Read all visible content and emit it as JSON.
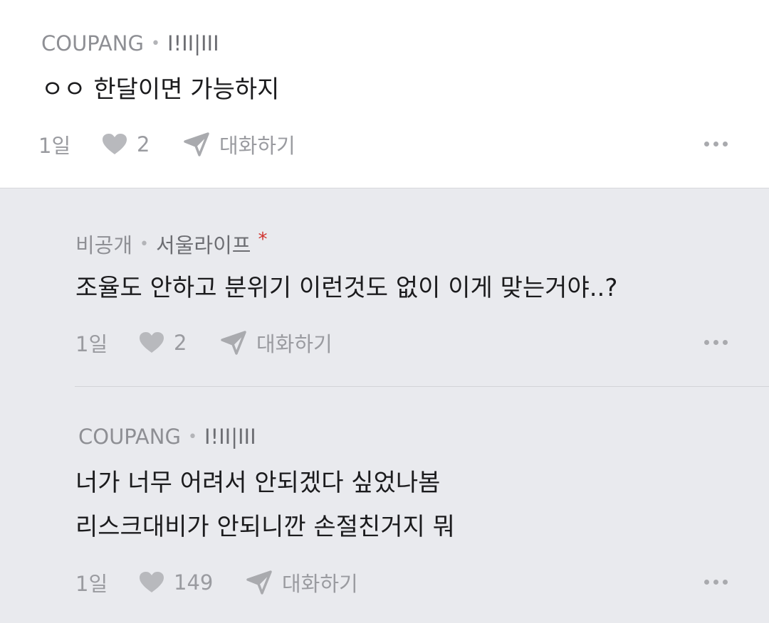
{
  "comments": [
    {
      "author": "COUPANG",
      "job": "I!II|III",
      "star": "",
      "lines": [
        "ㅇㅇ 한달이면 가능하지"
      ],
      "time": "1일",
      "likes": "2",
      "reply_label": "대화하기"
    },
    {
      "author": "비공개",
      "job": "서울라이프",
      "star": "*",
      "lines": [
        "조율도 안하고 분위기 이런것도 없이 이게 맞는거야..?"
      ],
      "time": "1일",
      "likes": "2",
      "reply_label": "대화하기"
    },
    {
      "author": "COUPANG",
      "job": "I!II|III",
      "star": "",
      "lines": [
        "너가 너무 어려서 안되겠다 싶었나봄",
        "리스크대비가 안되니깐 손절친거지 뭐"
      ],
      "time": "1일",
      "likes": "149",
      "reply_label": "대화하기"
    }
  ],
  "icons": {
    "like": "heart-icon",
    "reply": "paper-plane-icon",
    "more": "more-dots-icon"
  },
  "colors": {
    "star": "#d0312d",
    "reply_background": "#e9eaee",
    "top_background": "#ffffff"
  }
}
